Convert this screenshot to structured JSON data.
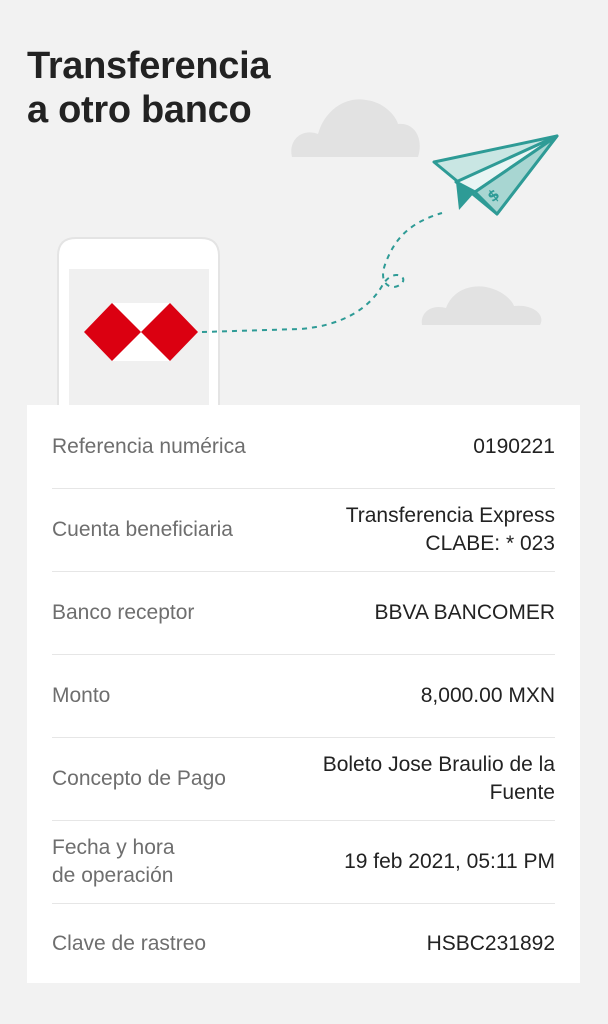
{
  "header": {
    "title_line1": "Transferencia",
    "title_line2": "a otro banco"
  },
  "illustration": {
    "logo_primary": "#db0011",
    "accent": "#2e9b96",
    "cloud_color": "#e2e2e2"
  },
  "details": {
    "rows": [
      {
        "label": "Referencia numérica",
        "value": "0190221"
      },
      {
        "label": "Cuenta beneficiaria",
        "value_line1": "Transferencia Express",
        "value_line2": "CLABE: * 023"
      },
      {
        "label": "Banco receptor",
        "value": "BBVA BANCOMER"
      },
      {
        "label": "Monto",
        "value": "8,000.00 MXN"
      },
      {
        "label": "Concepto de Pago",
        "value_line1": "Boleto Jose Braulio de la",
        "value_line2": "Fuente"
      },
      {
        "label_line1": "Fecha y hora",
        "label_line2": "de operación",
        "value": "19 feb 2021, 05:11 PM"
      },
      {
        "label": "Clave de rastreo",
        "value": "HSBC231892"
      }
    ]
  }
}
